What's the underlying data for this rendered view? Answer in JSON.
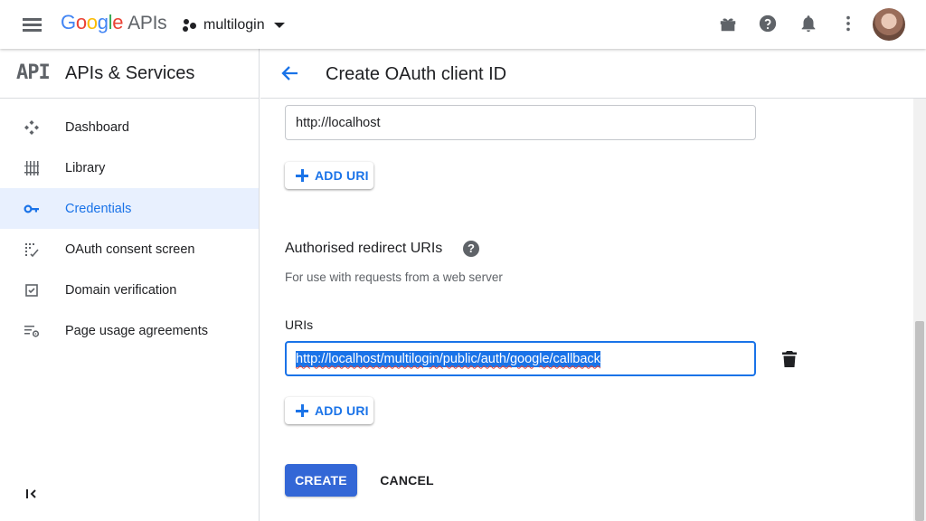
{
  "topbar": {
    "logo_google": [
      "G",
      "o",
      "o",
      "g",
      "l",
      "e"
    ],
    "logo_apis": "APIs",
    "project_name": "multilogin"
  },
  "sidebar": {
    "logo_text": "API",
    "title": "APIs & Services",
    "items": [
      {
        "label": "Dashboard",
        "icon": "dashboard-icon",
        "active": false
      },
      {
        "label": "Library",
        "icon": "library-icon",
        "active": false
      },
      {
        "label": "Credentials",
        "icon": "key-icon",
        "active": true
      },
      {
        "label": "OAuth consent screen",
        "icon": "consent-icon",
        "active": false
      },
      {
        "label": "Domain verification",
        "icon": "checkbox-icon",
        "active": false
      },
      {
        "label": "Page usage agreements",
        "icon": "settings-list-icon",
        "active": false
      }
    ],
    "collapse_icon": "collapse-sidebar-icon"
  },
  "main": {
    "title": "Create OAuth client ID",
    "origin_uri_value": "http://localhost",
    "add_uri_label": "ADD URI",
    "redirect_section_title": "Authorised redirect URIs",
    "redirect_section_desc": "For use with requests from a web server",
    "uris_label": "URIs",
    "redirect_uri_value": "http://localhost/multilogin/public/auth/google/callback",
    "create_label": "CREATE",
    "cancel_label": "CANCEL"
  },
  "colors": {
    "accent": "#1a73e8",
    "create_button": "#3367d6",
    "active_bg": "#e8f0fe"
  }
}
